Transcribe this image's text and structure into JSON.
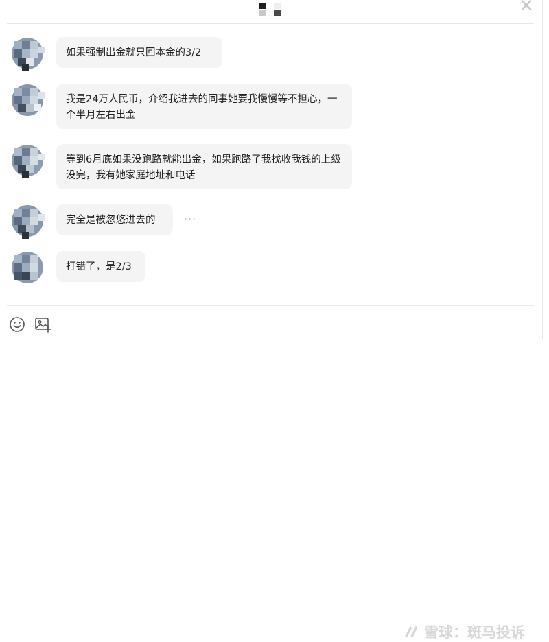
{
  "header": {
    "close_icon": "close-icon"
  },
  "messages": [
    {
      "text": "如果强制出金就只回本金的3/2"
    },
    {
      "text": "我是24万人民币，介绍我进去的同事她要我慢慢等不担心，一个半月左右出金"
    },
    {
      "text": "等到6月底如果没跑路就能出金，如果跑路了我找收我钱的上级没完，我有她家庭地址和电话"
    },
    {
      "text": "完全是被忽悠进去的",
      "more_label": "···"
    },
    {
      "text": "打错了，是2/3"
    }
  ],
  "toolbar": {
    "emoji_icon": "smile-icon",
    "image_icon": "image-add-icon"
  },
  "watermark": {
    "text": "雪球：斑马投诉"
  }
}
